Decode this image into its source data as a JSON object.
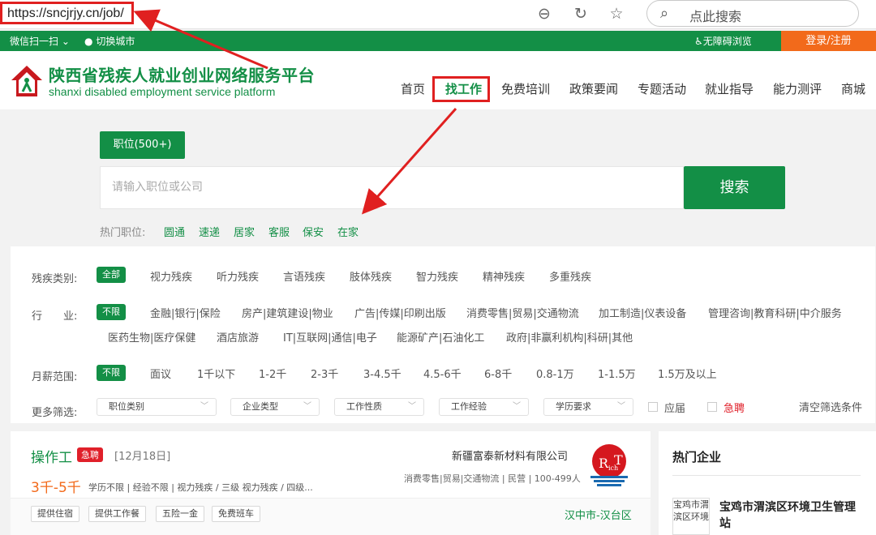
{
  "browser": {
    "url": "https://sncjrjy.cn/job/",
    "search_placeholder": "点此搜索"
  },
  "topbar": {
    "wechat": "微信扫一扫",
    "city": "切换城市",
    "accessibility": "无障碍浏览",
    "login": "登录/注册"
  },
  "header": {
    "title": "陕西省残疾人就业创业网络服务平台",
    "subtitle": "shanxi disabled employment service platform",
    "nav": [
      "首页",
      "找工作",
      "免费培训",
      "政策要闻",
      "专题活动",
      "就业指导",
      "能力测评",
      "商城"
    ],
    "active_nav": "找工作"
  },
  "search": {
    "tab_label": "职位(500+)",
    "input_placeholder": "请输入职位或公司",
    "button_label": "搜索",
    "hot_label": "热门职位:",
    "hot_jobs": [
      "圆通",
      "速递",
      "居家",
      "客服",
      "保安",
      "在家"
    ]
  },
  "filters": {
    "disability": {
      "label": "残疾类别:",
      "selected": "全部",
      "options": [
        "视力残疾",
        "听力残疾",
        "言语残疾",
        "肢体残疾",
        "智力残疾",
        "精神残疾",
        "多重残疾"
      ]
    },
    "industry": {
      "label": "行　　业:",
      "selected": "不限",
      "options_row1": [
        "金融|银行|保险",
        "房产|建筑建设|物业",
        "广告|传媒|印刷出版",
        "消费零售|贸易|交通物流",
        "加工制造|仪表设备",
        "管理咨询|教育科研|中介服务"
      ],
      "options_row2": [
        "医药生物|医疗保健",
        "酒店旅游",
        "IT|互联网|通信|电子",
        "能源矿产|石油化工",
        "政府|非赢利机构|科研|其他"
      ]
    },
    "salary": {
      "label": "月薪范围:",
      "selected": "不限",
      "options": [
        "面议",
        "1千以下",
        "1-2千",
        "2-3千",
        "3-4.5千",
        "4.5-6千",
        "6-8千",
        "0.8-1万",
        "1-1.5万",
        "1.5万及以上"
      ]
    },
    "more": {
      "label": "更多筛选:",
      "dropdowns": [
        "职位类别",
        "企业类型",
        "工作性质",
        "工作经验",
        "学历要求"
      ],
      "checkbox_fresh": "应届",
      "checkbox_urgent": "急聘",
      "clear": "清空筛选条件"
    }
  },
  "job": {
    "title": "操作工",
    "urgent_badge": "急聘",
    "date": "[12月18日]",
    "salary": "3千-5千",
    "requirements": "学历不限 | 经验不限 | 视力残疾 / 三级   视力残疾 / 四级...",
    "company": "新疆富泰新材料有限公司",
    "company_meta": "消费零售|贸易|交通物流 | 民营 | 100-499人",
    "benefits": [
      "提供住宿",
      "提供工作餐",
      "五险一金",
      "免费班车"
    ],
    "location": "汉中市-汉台区"
  },
  "sidebar": {
    "heading": "热门企业",
    "company_name": "宝鸡市渭滨区环境卫生管理站",
    "company_logo_alt": "宝鸡市渭滨区环境"
  },
  "colors": {
    "brand_green": "#138f46",
    "accent_orange": "#f26a1b",
    "annotation_red": "#e02020",
    "urgent_red": "#e0202a"
  }
}
